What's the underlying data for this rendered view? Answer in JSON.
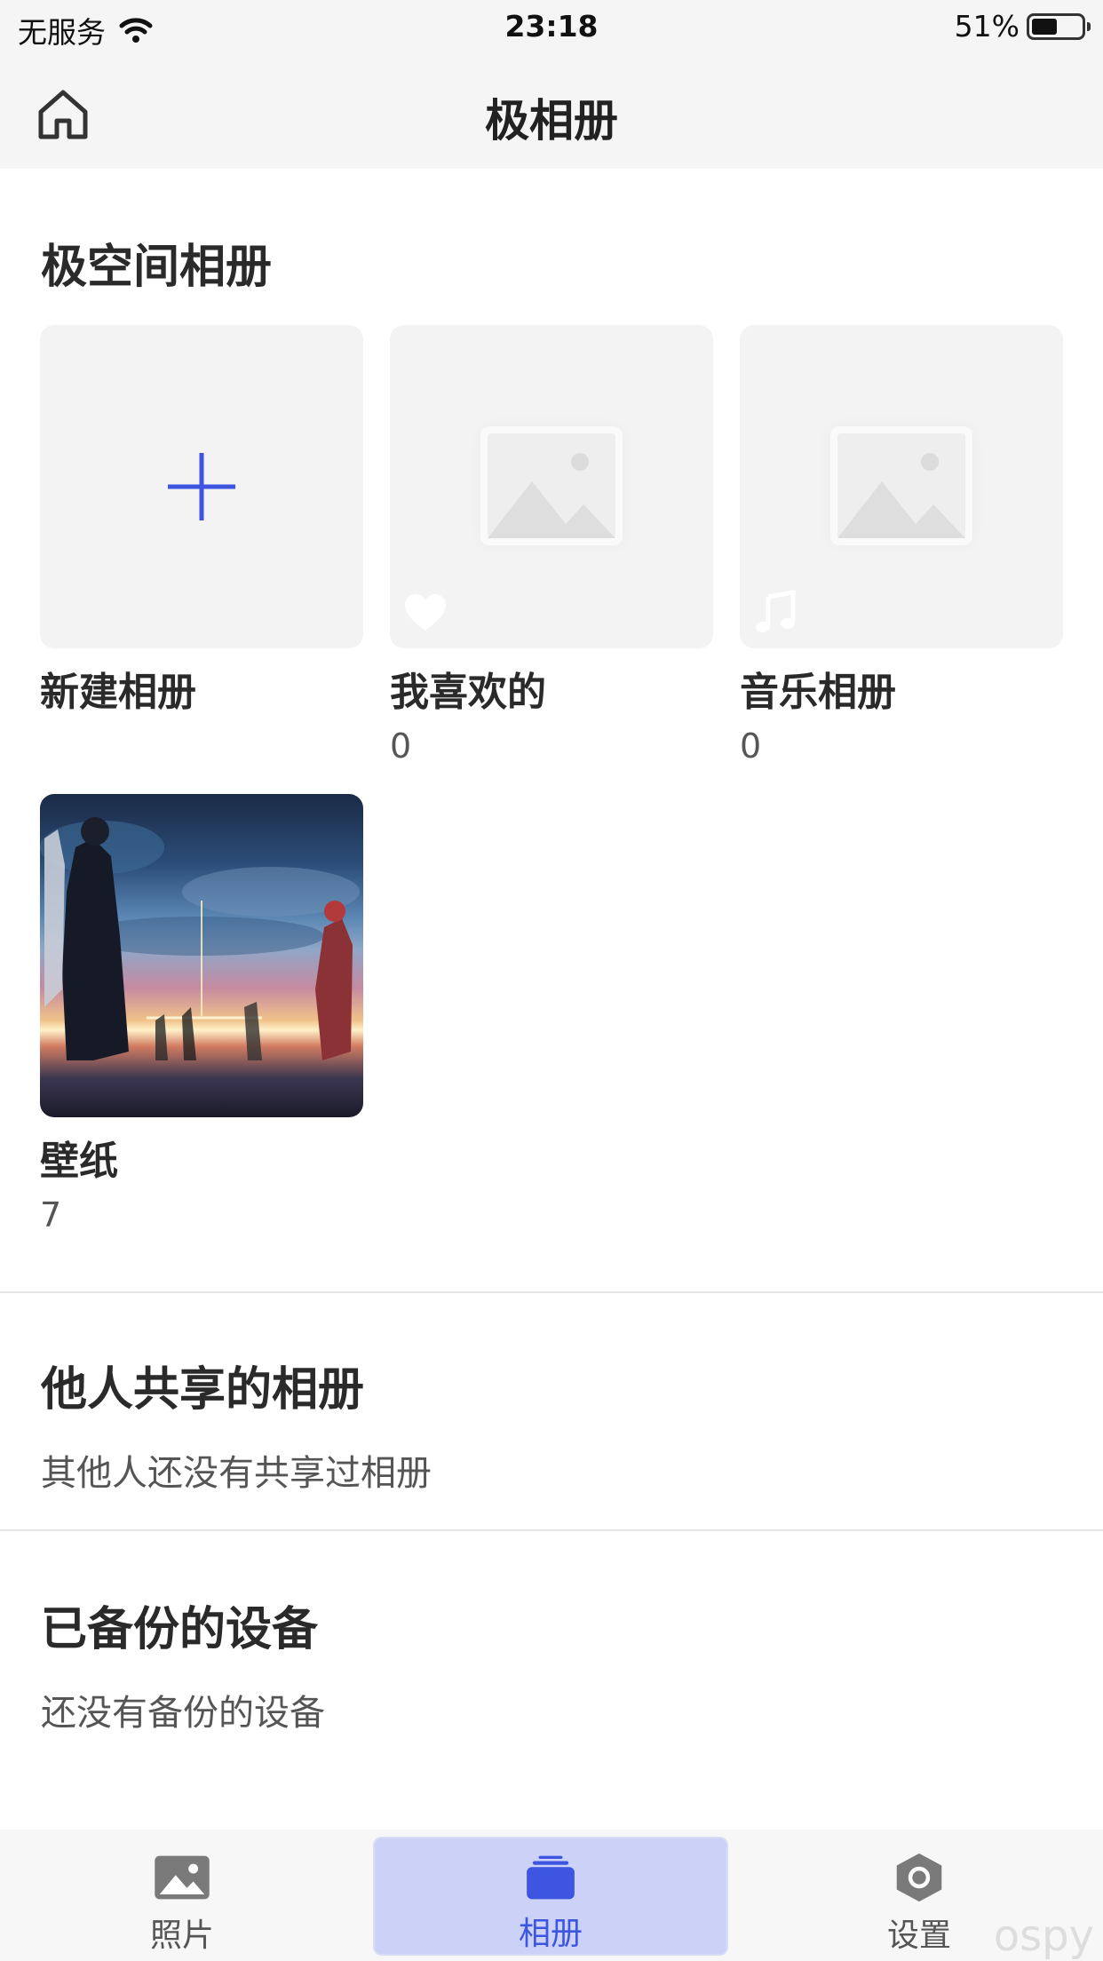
{
  "status_bar": {
    "carrier": "无服务",
    "time": "23:18",
    "battery_percent": "51%",
    "battery_level": 0.51
  },
  "header": {
    "title": "极相册"
  },
  "my_albums": {
    "title": "极空间相册",
    "items": [
      {
        "name": "新建相册",
        "count": "",
        "icon": "plus-icon"
      },
      {
        "name": "我喜欢的",
        "count": "0",
        "icon": "heart-icon"
      },
      {
        "name": "音乐相册",
        "count": "0",
        "icon": "music-note-icon"
      },
      {
        "name": "壁纸",
        "count": "7",
        "icon": "wallpaper-thumbnail"
      }
    ]
  },
  "shared_albums": {
    "title": "他人共享的相册",
    "empty_text": "其他人还没有共享过相册"
  },
  "backup_devices": {
    "title": "已备份的设备",
    "empty_text": "还没有备份的设备"
  },
  "bottom_nav": {
    "items": [
      {
        "label": "照片",
        "icon": "photo-icon",
        "active": false
      },
      {
        "label": "相册",
        "icon": "album-stack-icon",
        "active": true
      },
      {
        "label": "设置",
        "icon": "settings-hex-icon",
        "active": false
      }
    ]
  },
  "colors": {
    "accent": "#3d55e0",
    "active_tab_bg": "#ccd2f7",
    "thumb_bg": "#f3f3f3"
  },
  "watermark": "ospy"
}
